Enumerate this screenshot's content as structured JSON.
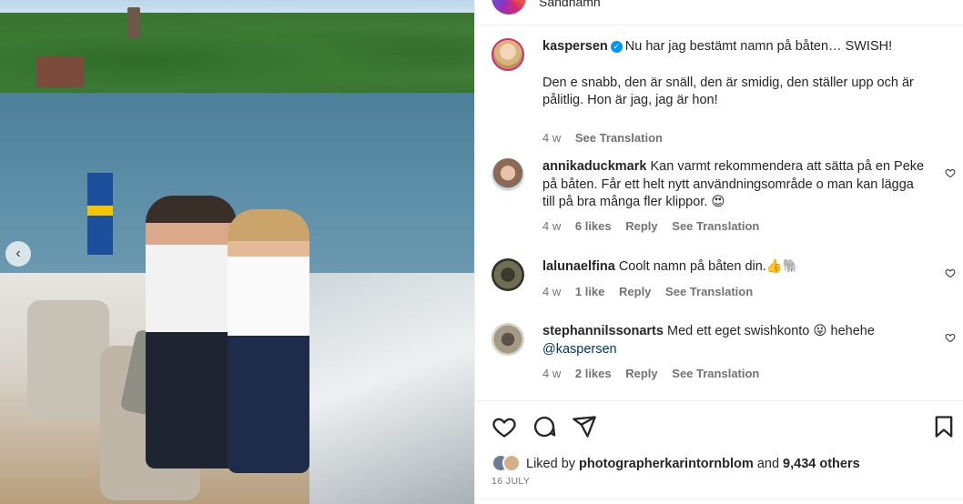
{
  "post": {
    "location_partial": "Sandhamn",
    "caption": {
      "username": "kaspersen",
      "verified": true,
      "line1": "Nu har jag bestämt namn på båten… SWISH!",
      "line2": "Den e snabb, den är snäll, den är smidig, den ställer upp och är pålitlig. Hon är jag, jag är hon!",
      "time": "4 w",
      "see_translation": "See Translation"
    },
    "comments": [
      {
        "username": "annikaduckmark",
        "text": "Kan varmt rekommendera att sätta på en Peke på båten. Får ett helt nytt användningsområde o man kan lägga till på bra många fler klippor. 😍",
        "time": "4 w",
        "likes": "6 likes",
        "reply": "Reply",
        "see_translation": "See Translation"
      },
      {
        "username": "lalunaelfina",
        "text": "Coolt namn på båten din.👍🐘",
        "time": "4 w",
        "likes": "1 like",
        "reply": "Reply",
        "see_translation": "See Translation"
      },
      {
        "username": "stephannilssonarts",
        "text": "Med ett eget swishkonto 😜 hehehe",
        "mention": "@kaspersen",
        "time": "4 w",
        "likes": "2 likes",
        "reply": "Reply",
        "see_translation": "See Translation"
      }
    ],
    "likes": {
      "prefix": "Liked by",
      "user": "photographerkarintornblom",
      "and": "and",
      "others": "9,434 others"
    },
    "date": "16 JULY"
  },
  "icons": [
    "like-icon",
    "comment-icon",
    "share-icon",
    "save-icon",
    "chevron-left-icon",
    "heart-small-icon",
    "verified-icon"
  ],
  "colors": {
    "verified": "#0095f6",
    "text": "#262626",
    "meta": "#737373",
    "mention": "#00376b"
  }
}
